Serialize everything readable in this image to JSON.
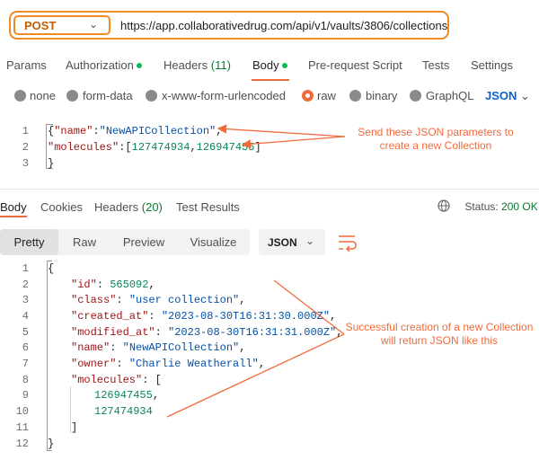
{
  "request": {
    "method": "POST",
    "url": "https://app.collaborativedrug.com/api/v1/vaults/3806/collections"
  },
  "request_tabs": [
    {
      "label": "Params"
    },
    {
      "label": "Authorization"
    },
    {
      "label": "Headers",
      "count": "(11)"
    },
    {
      "label": "Body"
    },
    {
      "label": "Pre-request Script"
    },
    {
      "label": "Tests"
    },
    {
      "label": "Settings"
    }
  ],
  "body_types": {
    "options": [
      "none",
      "form-data",
      "x-www-form-urlencoded",
      "raw",
      "binary",
      "GraphQL"
    ],
    "selected": "raw",
    "format": "JSON"
  },
  "request_body": {
    "line_numbers": [
      "1",
      "2",
      "3"
    ],
    "line1_open": "{",
    "name_key": "\"name\"",
    "colon": ":",
    "name_value": "\"NewAPICollection\"",
    "comma": ",",
    "molecules_key": "\"molecules\"",
    "bracket_open": "[",
    "mol1": "127474934",
    "mol2": "126947455",
    "bracket_close": "]",
    "line3_close": "}"
  },
  "annotations": {
    "request_note_line1": "Send these JSON parameters to",
    "request_note_line2": "create a new Collection",
    "response_note_line1": "Successful creation of a new Collection",
    "response_note_line2": "will return JSON like this"
  },
  "response_tabs": [
    {
      "label": "Body"
    },
    {
      "label": "Cookies"
    },
    {
      "label": "Headers",
      "count": "(20)"
    },
    {
      "label": "Test Results"
    }
  ],
  "status": {
    "label": "Status:",
    "value": "200 OK"
  },
  "view_modes": [
    "Pretty",
    "Raw",
    "Preview",
    "Visualize"
  ],
  "response_format": "JSON",
  "response_body": {
    "line_numbers": [
      "1",
      "2",
      "3",
      "4",
      "5",
      "6",
      "7",
      "8",
      "9",
      "10",
      "11",
      "12"
    ],
    "open": "{",
    "id_key": "\"id\"",
    "id_value": "565092",
    "class_key": "\"class\"",
    "class_value": "\"user collection\"",
    "created_key": "\"created_at\"",
    "created_value": "\"2023-08-30T16:31:30.000Z\"",
    "modified_key": "\"modified_at\"",
    "modified_value": "\"2023-08-30T16:31:31.000Z\"",
    "name_key": "\"name\"",
    "name_value": "\"NewAPICollection\"",
    "owner_key": "\"owner\"",
    "owner_value": "\"Charlie Weatherall\"",
    "molecules_key": "\"molecules\"",
    "bracket_open": "[",
    "mol1": "126947455",
    "mol2": "127474934",
    "bracket_close": "]",
    "close": "}"
  },
  "colors": {
    "accent": "#f26b3a",
    "highlight_border": "#f08a24",
    "link_blue": "#0b63ce",
    "success_green": "#0a7a2f"
  }
}
